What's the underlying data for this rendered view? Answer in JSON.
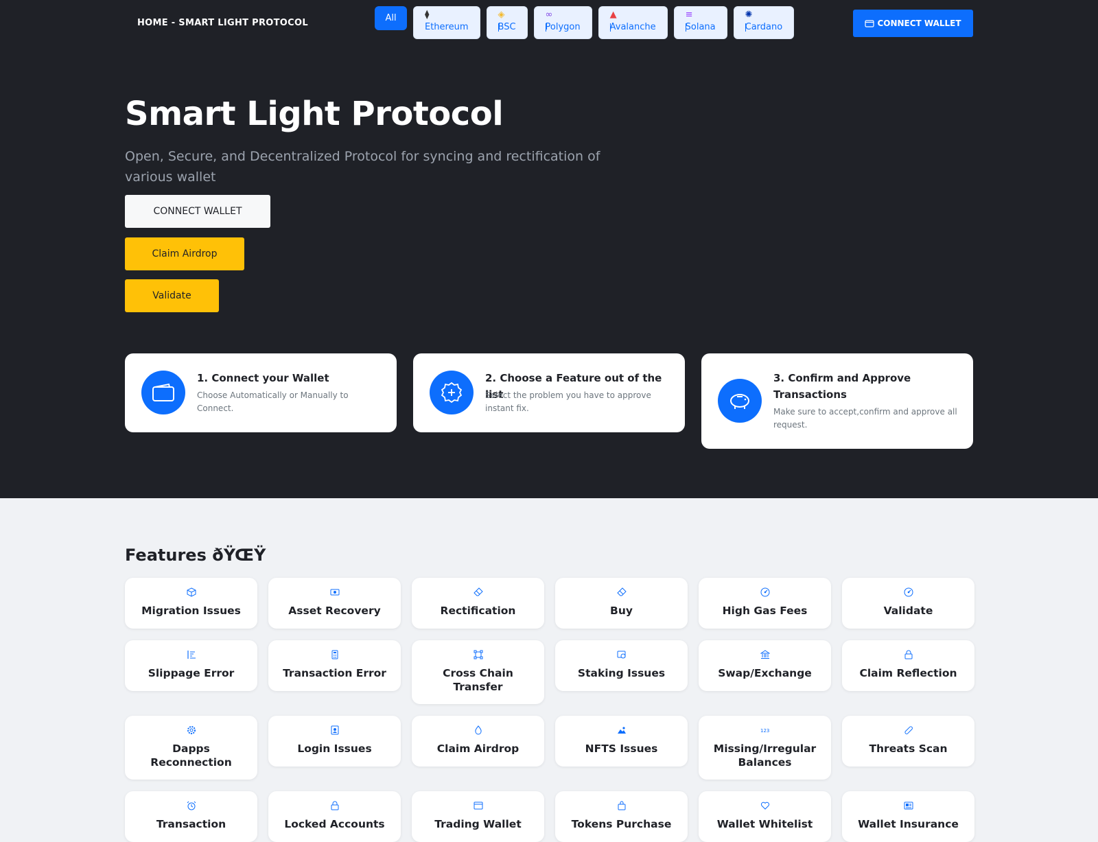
{
  "nav": {
    "brand": "HOME - SMART LIGHT PROTOCOL",
    "all_label": "All",
    "chains": [
      {
        "label": "Ethereum",
        "icon": "ethereum-icon",
        "glyph": "⧫",
        "color": "#343434"
      },
      {
        "label": "BSC",
        "icon": "bsc-icon",
        "glyph": "◈",
        "color": "#f3ba2f"
      },
      {
        "label": "Polygon",
        "icon": "polygon-icon",
        "glyph": "∞",
        "color": "#8247e5"
      },
      {
        "label": "Avalanche",
        "icon": "avalanche-icon",
        "glyph": "▲",
        "color": "#e84142"
      },
      {
        "label": "Solana",
        "icon": "solana-icon",
        "glyph": "≡",
        "color": "#9945ff"
      },
      {
        "label": "Cardano",
        "icon": "cardano-icon",
        "glyph": "✺",
        "color": "#0033ad"
      }
    ],
    "connect_label": "CONNECT WALLET"
  },
  "hero": {
    "title": "Smart Light Protocol",
    "subtitle": "Open, Secure, and Decentralized Protocol for syncing and rectification of various wallet",
    "connect_label": "CONNECT WALLET",
    "claim_label": "Claim Airdrop",
    "validate_label": "Validate"
  },
  "steps": [
    {
      "title": "1. Connect your Wallet",
      "desc": "Choose Automatically or Manually to Connect.",
      "icon": "wallet-icon"
    },
    {
      "title": "2. Choose a Feature out of the list",
      "desc": "Select the problem you have to approve instant fix.",
      "icon": "plus-badge-icon"
    },
    {
      "title": "3. Confirm and Approve Transactions",
      "desc": "Make sure to accept,confirm and approve all request.",
      "icon": "piggy-bank-icon"
    }
  ],
  "features": {
    "title": "Features ðŸŒŸ",
    "items": [
      {
        "label": "Migration Issues",
        "icon": "box-icon"
      },
      {
        "label": "Asset Recovery",
        "icon": "cash-icon"
      },
      {
        "label": "Rectification",
        "icon": "eraser-icon"
      },
      {
        "label": "Buy",
        "icon": "eraser-icon"
      },
      {
        "label": "High Gas Fees",
        "icon": "speedometer-icon"
      },
      {
        "label": "Validate",
        "icon": "speedometer-icon"
      },
      {
        "label": "Slippage Error",
        "icon": "sort-icon"
      },
      {
        "label": "Transaction Error",
        "icon": "calculator-icon"
      },
      {
        "label": "Cross Chain Transfer",
        "icon": "bounding-box-icon"
      },
      {
        "label": "Staking Issues",
        "icon": "coin-icon"
      },
      {
        "label": "Swap/Exchange",
        "icon": "bank-icon"
      },
      {
        "label": "Claim Reflection",
        "icon": "lock-icon"
      },
      {
        "label": "Dapps Reconnection",
        "icon": "gear-icon"
      },
      {
        "label": "Login Issues",
        "icon": "person-badge-icon"
      },
      {
        "label": "Claim Airdrop",
        "icon": "droplet-icon"
      },
      {
        "label": "NFTS Issues",
        "icon": "image-icon"
      },
      {
        "label": "Missing/Irregular Balances",
        "icon": "numbers-icon"
      },
      {
        "label": "Threats Scan",
        "icon": "bandaid-icon"
      },
      {
        "label": "Transaction",
        "icon": "alarm-icon"
      },
      {
        "label": "Locked Accounts",
        "icon": "lock-icon"
      },
      {
        "label": "Trading Wallet",
        "icon": "window-icon"
      },
      {
        "label": "Tokens Purchase",
        "icon": "bag-icon"
      },
      {
        "label": "Wallet Whitelist",
        "icon": "heart-icon"
      },
      {
        "label": "Wallet Insurance",
        "icon": "receipt-icon"
      }
    ]
  },
  "colors": {
    "hero_bg": "#1f2127",
    "accent": "#0d6efd",
    "yellow": "#ffc107",
    "page_bg": "#f0f2f5"
  }
}
